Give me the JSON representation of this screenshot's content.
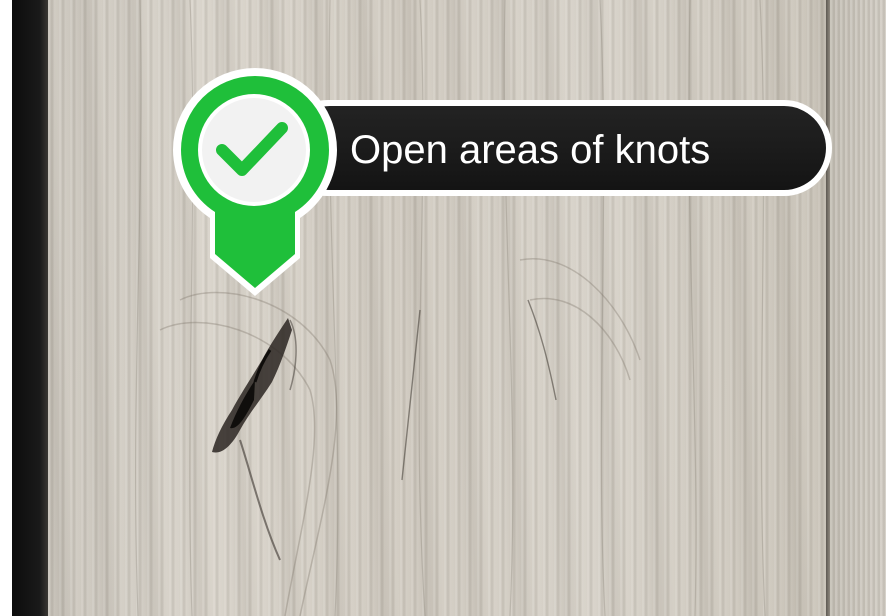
{
  "badge": {
    "label": "Open areas of knots",
    "icon": "checkmark-icon",
    "accent_color": "#1fbf3a",
    "pill_color": "#1a1a1a"
  }
}
